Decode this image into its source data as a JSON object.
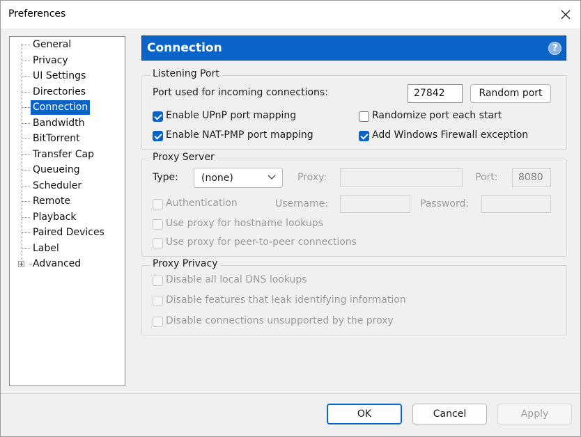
{
  "window": {
    "title": "Preferences"
  },
  "nav": {
    "items": [
      {
        "label": "General"
      },
      {
        "label": "Privacy"
      },
      {
        "label": "UI Settings"
      },
      {
        "label": "Directories"
      },
      {
        "label": "Connection",
        "selected": true
      },
      {
        "label": "Bandwidth"
      },
      {
        "label": "BitTorrent"
      },
      {
        "label": "Transfer Cap"
      },
      {
        "label": "Queueing"
      },
      {
        "label": "Scheduler"
      },
      {
        "label": "Remote"
      },
      {
        "label": "Playback"
      },
      {
        "label": "Paired Devices"
      },
      {
        "label": "Label"
      },
      {
        "label": "Advanced",
        "expandable": true
      }
    ]
  },
  "panel": {
    "title": "Connection",
    "help": "?"
  },
  "listening": {
    "title": "Listening Port",
    "port_label": "Port used for incoming connections:",
    "port_value": "27842",
    "random_button": "Random port",
    "upnp": {
      "label": "Enable UPnP port mapping",
      "checked": true
    },
    "natpmp": {
      "label": "Enable NAT-PMP port mapping",
      "checked": true
    },
    "randomize": {
      "label": "Randomize port each start",
      "checked": false
    },
    "firewall": {
      "label": "Add Windows Firewall exception",
      "checked": true
    }
  },
  "proxy": {
    "title": "Proxy Server",
    "type_label": "Type:",
    "type_value": "(none)",
    "proxy_label": "Proxy:",
    "proxy_value": "",
    "port_label": "Port:",
    "port_value": "8080",
    "auth_label": "Authentication",
    "username_label": "Username:",
    "password_label": "Password:",
    "hostname_label": "Use proxy for hostname lookups",
    "p2p_label": "Use proxy for peer-to-peer connections"
  },
  "privacy": {
    "title": "Proxy Privacy",
    "dns_label": "Disable all local DNS lookups",
    "leak_label": "Disable features that leak identifying information",
    "unsupported_label": "Disable connections unsupported by the proxy"
  },
  "footer": {
    "ok": "OK",
    "cancel": "Cancel",
    "apply": "Apply"
  },
  "colors": {
    "accent": "#0a64c8",
    "panel_header": "#0a64c8"
  }
}
